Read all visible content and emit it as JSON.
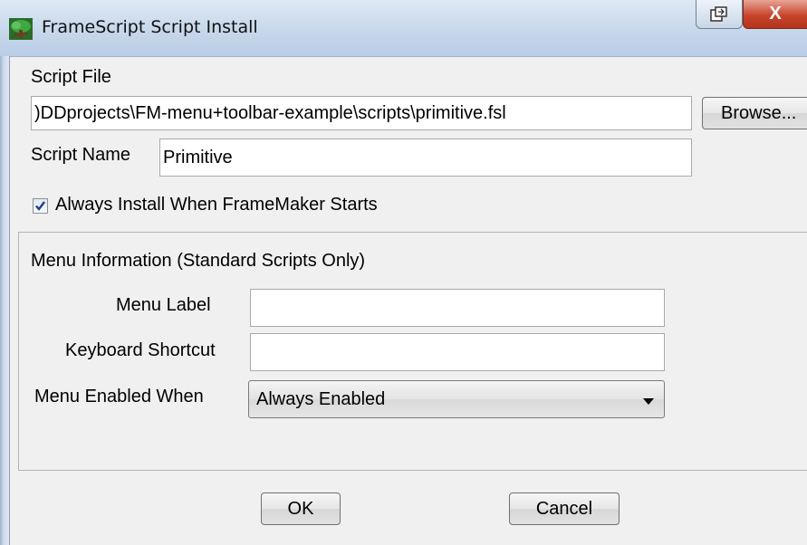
{
  "window": {
    "title": "FrameScript Script Install",
    "close_label": "X"
  },
  "script_file": {
    "label": "Script File",
    "value": ")DDprojects\\FM-menu+toolbar-example\\scripts\\primitive.fsl",
    "browse_label": "Browse..."
  },
  "script_name": {
    "label": "Script Name",
    "value": "Primitive"
  },
  "always_install": {
    "label": "Always Install When FrameMaker Starts",
    "checked": true
  },
  "menu_info": {
    "title": "Menu Information (Standard Scripts Only)",
    "menu_label": {
      "label": "Menu Label",
      "value": ""
    },
    "keyboard_shortcut": {
      "label": "Keyboard Shortcut",
      "value": ""
    },
    "menu_enabled": {
      "label": "Menu Enabled When",
      "value": "Always Enabled"
    }
  },
  "buttons": {
    "ok": "OK",
    "cancel": "Cancel"
  },
  "icons": {
    "app": "framescript-tree-icon",
    "restore": "restore-window-icon",
    "close": "close-icon",
    "checkbox": "checkmark-icon",
    "dropdown": "chevron-down-icon"
  }
}
